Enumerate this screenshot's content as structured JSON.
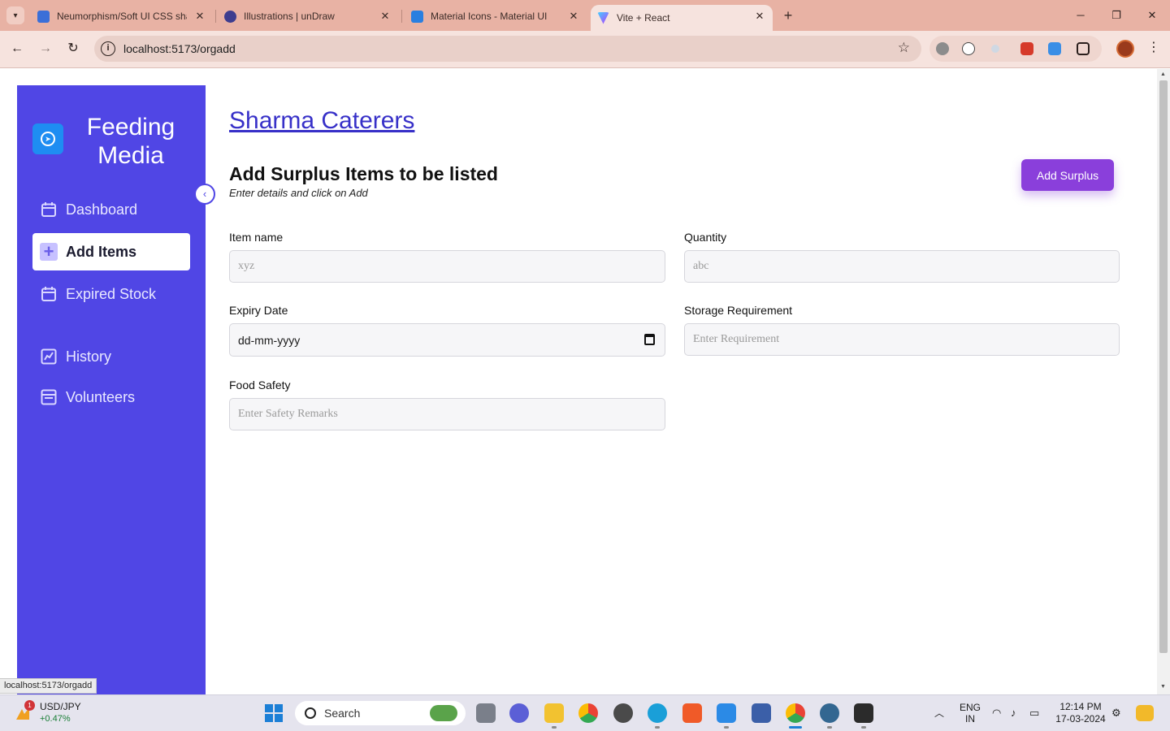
{
  "browser": {
    "tabs": [
      {
        "title": "Neumorphism/Soft UI CSS shad",
        "favicon_color": "#3b6fd8",
        "active": false
      },
      {
        "title": "Illustrations | unDraw",
        "favicon_color": "#3d3d8f",
        "active": false
      },
      {
        "title": "Material Icons - Material UI",
        "favicon_color": "#2a7fe0",
        "active": false
      },
      {
        "title": "Vite + React",
        "favicon_color": "#a855f7",
        "active": true
      }
    ],
    "url": "localhost:5173/orgadd",
    "status_url": "localhost:5173/orgadd"
  },
  "sidebar": {
    "brand": "Feeding Media",
    "collapse_glyph": "‹",
    "items": [
      {
        "label": "Dashboard",
        "icon": "calendar-icon",
        "active": false
      },
      {
        "label": "Add Items",
        "icon": "add-box-icon",
        "active": true
      },
      {
        "label": "Expired Stock",
        "icon": "calendar-icon",
        "active": false
      },
      {
        "label": "History",
        "icon": "chart-icon",
        "active": false
      },
      {
        "label": "Volunteers",
        "icon": "list-icon",
        "active": false
      }
    ],
    "accent": "#5046e5"
  },
  "main": {
    "org_name": "Sharma Caterers",
    "title": "Add Surplus Items to be listed",
    "subtitle": "Enter details and click on Add",
    "add_button": "Add Surplus",
    "fields": {
      "item_name": {
        "label": "Item name",
        "placeholder": "xyz"
      },
      "quantity": {
        "label": "Quantity",
        "placeholder": "abc"
      },
      "expiry_date": {
        "label": "Expiry Date",
        "value": "dd-mm-yyyy"
      },
      "storage": {
        "label": "Storage Requirement",
        "placeholder": "Enter Requirement"
      },
      "food_safety": {
        "label": "Food Safety",
        "placeholder": "Enter Safety Remarks"
      }
    },
    "button_color": "#8a3fdb"
  },
  "taskbar": {
    "ticker_name": "USD/JPY",
    "ticker_change": "+0.47%",
    "ticker_badge": "1",
    "search": "Search",
    "lang_top": "ENG",
    "lang_bottom": "IN",
    "time": "12:14 PM",
    "date": "17-03-2024"
  }
}
